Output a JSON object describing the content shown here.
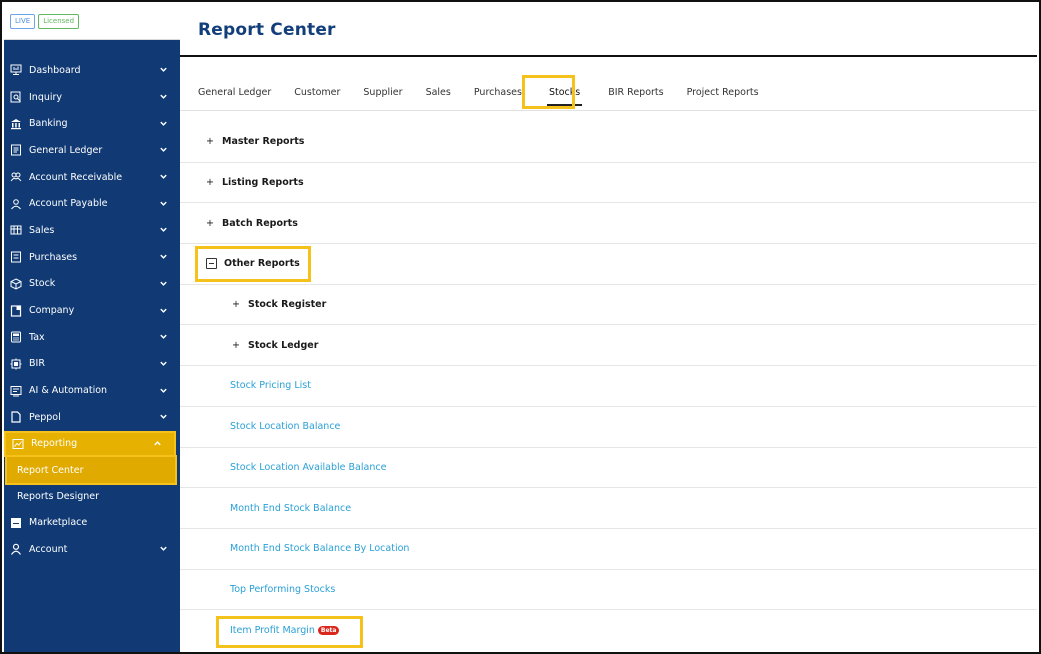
{
  "badges": {
    "live": "LIVE",
    "licensed": "Licensed"
  },
  "sidebar": {
    "items": [
      {
        "label": "Dashboard",
        "icon": "dashboard-icon"
      },
      {
        "label": "Inquiry",
        "icon": "inquiry-icon"
      },
      {
        "label": "Banking",
        "icon": "bank-icon"
      },
      {
        "label": "General Ledger",
        "icon": "ledger-icon"
      },
      {
        "label": "Account Receivable",
        "icon": "receivable-icon"
      },
      {
        "label": "Account Payable",
        "icon": "payable-icon"
      },
      {
        "label": "Sales",
        "icon": "sales-icon"
      },
      {
        "label": "Purchases",
        "icon": "purchases-icon"
      },
      {
        "label": "Stock",
        "icon": "stock-icon"
      },
      {
        "label": "Company",
        "icon": "company-icon"
      },
      {
        "label": "Tax",
        "icon": "tax-icon"
      },
      {
        "label": "BIR",
        "icon": "bir-icon"
      },
      {
        "label": "AI & Automation",
        "icon": "ai-icon"
      },
      {
        "label": "Peppol",
        "icon": "peppol-icon"
      },
      {
        "label": "Reporting",
        "icon": "reporting-icon"
      }
    ],
    "reporting_sub": [
      "Report Center",
      "Reports Designer"
    ],
    "marketplace": "Marketplace",
    "account": "Account"
  },
  "header": {
    "title": "Report Center"
  },
  "tabs": [
    "General Ledger",
    "Customer",
    "Supplier",
    "Sales",
    "Purchases",
    "Stocks",
    "BIR Reports",
    "Project Reports"
  ],
  "sections": {
    "master": "Master Reports",
    "listing": "Listing Reports",
    "batch": "Batch Reports",
    "other": "Other Reports"
  },
  "other_reports": {
    "stock_register": "Stock Register",
    "stock_ledger": "Stock Ledger",
    "links": [
      "Stock Pricing List",
      "Stock Location Balance",
      "Stock Location Available Balance",
      "Month End Stock Balance",
      "Month End Stock Balance By Location",
      "Top Performing Stocks",
      "Item Profit Margin"
    ],
    "beta": "Beta"
  },
  "colors": {
    "sidebar": "#113a74",
    "highlight": "#f5c21c",
    "link": "#2aa0d6",
    "title": "#123e7a"
  }
}
